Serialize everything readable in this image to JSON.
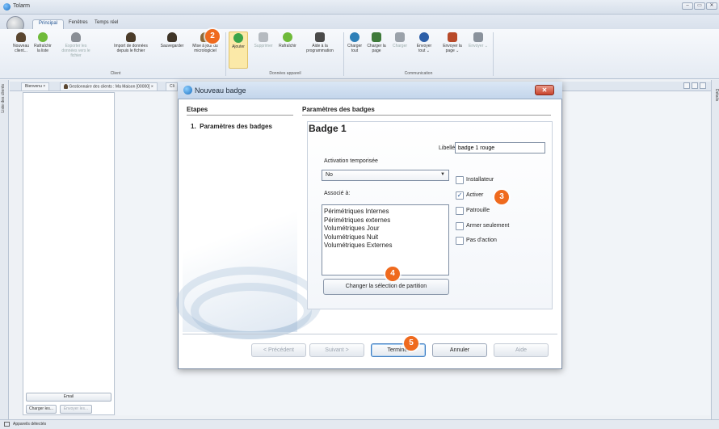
{
  "window": {
    "app_title": "Tolarm",
    "controls": [
      "–",
      "▭",
      "✕"
    ]
  },
  "ribbon": {
    "tabs": [
      "Principal",
      "Fenêtres",
      "Temps réel"
    ],
    "active_tab": "Principal",
    "groups": [
      {
        "label": "Client",
        "buttons": [
          {
            "label": "Nouveau client...",
            "icon": "new-client-icon"
          },
          {
            "label": "Rafraîchir la liste",
            "icon": "refresh-icon"
          },
          {
            "label": "Exporter les données vers le fichier",
            "icon": "export-icon",
            "disabled": true
          },
          {
            "label": "Import de données depuis le fichier",
            "icon": "import-icon"
          },
          {
            "label": "Sauvegarder",
            "icon": "save-icon"
          },
          {
            "label": "Mise à jour du micrologiciel",
            "icon": "firmware-icon"
          }
        ]
      },
      {
        "label": "Données appareil",
        "buttons": [
          {
            "label": "Ajouter",
            "icon": "add-icon",
            "selected": true
          },
          {
            "label": "Supprimer",
            "icon": "delete-icon",
            "disabled": true
          },
          {
            "label": "Rafraîchir",
            "icon": "refresh-icon"
          },
          {
            "label": "Aide à la programmation",
            "icon": "help-programming-icon"
          }
        ]
      },
      {
        "label": "Communication",
        "buttons": [
          {
            "label": "Charger tout",
            "icon": "load-all-icon"
          },
          {
            "label": "Charger la page",
            "icon": "load-page-icon"
          },
          {
            "label": "Charger",
            "icon": "load-icon",
            "disabled": true
          },
          {
            "label": "Envoyer tout ⌄",
            "icon": "send-all-icon"
          },
          {
            "label": "Envoyer la page ⌄",
            "icon": "send-page-icon"
          },
          {
            "label": "Envoyer ⌄",
            "icon": "send-icon",
            "disabled": true
          }
        ]
      }
    ]
  },
  "side": {
    "left_label": "Liste des clients",
    "right_label": "Détails"
  },
  "doc_tabs": [
    {
      "label": "Bienvenu"
    },
    {
      "label": "Gestionnaire des clients : Ma Maison [00000]"
    },
    {
      "label": "Cli"
    }
  ],
  "client_panel": {
    "email_button": "Email",
    "load_button": "Charger les...",
    "send_button": "Envoyer les..."
  },
  "status": {
    "text": "Appareils détectés"
  },
  "dialog": {
    "title": "Nouveau badge",
    "steps_header": "Etapes",
    "steps": [
      {
        "num": "1.",
        "label": "Paramètres des badges"
      }
    ],
    "params_header": "Paramètres des badges",
    "badge_title": "Badge 1",
    "libelle_label": "Libellé",
    "libelle_value": "badge 1 rouge",
    "activation_label": "Activation temporisée",
    "activation_value": "No",
    "associe_label": "Associé à:",
    "partitions": [
      "Périmétriques Internes",
      "Périmétriques externes",
      "Volumétriques Jour",
      "Volumétriques Nuit",
      "Volumétriques Externes"
    ],
    "change_partition_button": "Changer la sélection de partition",
    "checkboxes": [
      {
        "label": "Installateur",
        "checked": false
      },
      {
        "label": "Activer",
        "checked": true
      },
      {
        "label": "Patrouille",
        "checked": false
      },
      {
        "label": "Armer seulement",
        "checked": false
      },
      {
        "label": "Pas d'action",
        "checked": false
      }
    ],
    "buttons": {
      "prev": "< Précédent",
      "next": "Suivant >",
      "finish": "Terminer",
      "cancel": "Annuler",
      "help": "Aide"
    }
  },
  "callouts": [
    "2",
    "3",
    "4",
    "5"
  ],
  "colors": {
    "callout": "#ef6a1e",
    "accent": "#1a6fc0",
    "dialog_close": "#c8432c"
  }
}
